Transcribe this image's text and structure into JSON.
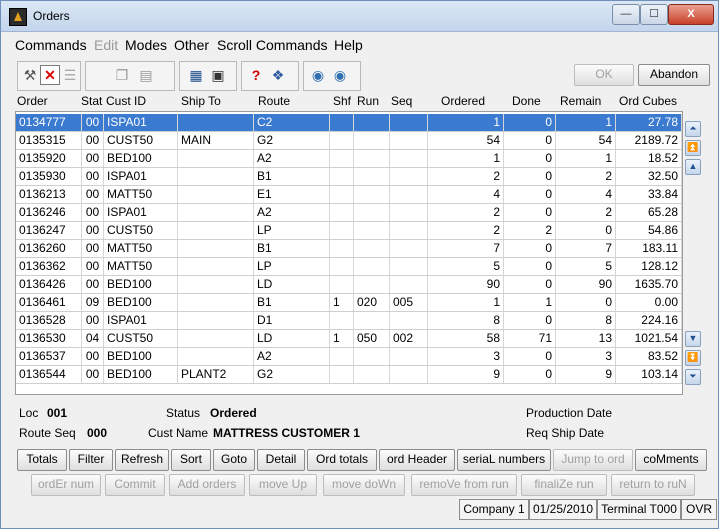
{
  "window": {
    "title": "Orders",
    "minimize_glyph": "—",
    "maximize_glyph": "☐",
    "close_glyph": "X"
  },
  "menu": [
    "Commands",
    "Edit",
    "Modes",
    "Other",
    "Scroll Commands",
    "Help"
  ],
  "toolbar": {
    "ok_label": "OK",
    "abandon_label": "Abandon"
  },
  "table": {
    "columns": [
      "Order",
      "Stat",
      "Cust ID",
      "Ship To",
      "Route",
      "Shf",
      "Run",
      "Seq",
      "Ordered",
      "Done",
      "Remain",
      "Ord Cubes"
    ],
    "rows": [
      [
        "0134777",
        "00",
        "ISPA01",
        "",
        "C2",
        "",
        "",
        "",
        "1",
        "0",
        "1",
        "27.78"
      ],
      [
        "0135315",
        "00",
        "CUST50",
        "MAIN",
        "G2",
        "",
        "",
        "",
        "54",
        "0",
        "54",
        "2189.72"
      ],
      [
        "0135920",
        "00",
        "BED100",
        "",
        "A2",
        "",
        "",
        "",
        "1",
        "0",
        "1",
        "18.52"
      ],
      [
        "0135930",
        "00",
        "ISPA01",
        "",
        "B1",
        "",
        "",
        "",
        "2",
        "0",
        "2",
        "32.50"
      ],
      [
        "0136213",
        "00",
        "MATT50",
        "",
        "E1",
        "",
        "",
        "",
        "4",
        "0",
        "4",
        "33.84"
      ],
      [
        "0136246",
        "00",
        "ISPA01",
        "",
        "A2",
        "",
        "",
        "",
        "2",
        "0",
        "2",
        "65.28"
      ],
      [
        "0136247",
        "00",
        "CUST50",
        "",
        "LP",
        "",
        "",
        "",
        "2",
        "2",
        "0",
        "54.86"
      ],
      [
        "0136260",
        "00",
        "MATT50",
        "",
        "B1",
        "",
        "",
        "",
        "7",
        "0",
        "7",
        "183.11"
      ],
      [
        "0136362",
        "00",
        "MATT50",
        "",
        "LP",
        "",
        "",
        "",
        "5",
        "0",
        "5",
        "128.12"
      ],
      [
        "0136426",
        "00",
        "BED100",
        "",
        "LD",
        "",
        "",
        "",
        "90",
        "0",
        "90",
        "1635.70"
      ],
      [
        "0136461",
        "09",
        "BED100",
        "",
        "B1",
        "1",
        "020",
        "005",
        "1",
        "1",
        "0",
        "0.00"
      ],
      [
        "0136528",
        "00",
        "ISPA01",
        "",
        "D1",
        "",
        "",
        "",
        "8",
        "0",
        "8",
        "224.16"
      ],
      [
        "0136530",
        "04",
        "CUST50",
        "",
        "LD",
        "1",
        "050",
        "002",
        "58",
        "71",
        "13",
        "1021.54"
      ],
      [
        "0136537",
        "00",
        "BED100",
        "",
        "A2",
        "",
        "",
        "",
        "3",
        "0",
        "3",
        "83.52"
      ],
      [
        "0136544",
        "00",
        "BED100",
        "PLANT2",
        "G2",
        "",
        "",
        "",
        "9",
        "0",
        "9",
        "103.14"
      ]
    ]
  },
  "info": {
    "loc_label": "Loc",
    "loc_value": "001",
    "status_label": "Status",
    "status_value": "Ordered",
    "production_date_label": "Production Date",
    "route_seq_label": "Route Seq",
    "route_seq_value": "000",
    "cust_name_label": "Cust Name",
    "cust_name_value": "MATTRESS CUSTOMER 1",
    "req_ship_date_label": "Req Ship Date"
  },
  "buttons_row1": [
    "Totals",
    "Filter",
    "Refresh",
    "Sort",
    "Goto",
    "Detail",
    "Ord totals",
    "ord Header",
    "seriaL numbers",
    "Jump to ord",
    "coMments"
  ],
  "buttons_row2": [
    "ordEr num",
    "Commit",
    "Add orders",
    "move Up",
    "move doWn",
    "remoVe from run",
    "finaliZe run",
    "return to ruN"
  ],
  "status": {
    "company": "Company 1",
    "date": "01/25/2010",
    "terminal": "Terminal T000",
    "mode": "OVR"
  },
  "colors": {
    "selection": "#3a7ad0",
    "close_red": "#c8402a",
    "help_red": "#cc0000"
  }
}
